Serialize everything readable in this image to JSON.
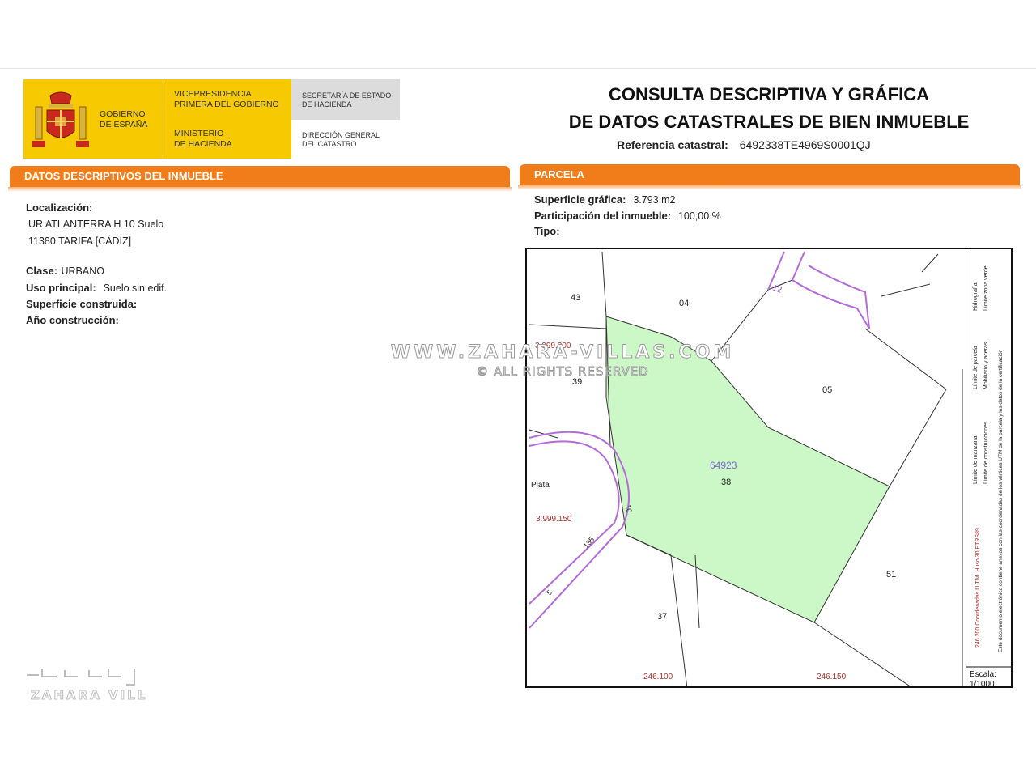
{
  "header": {
    "gobierno": [
      "GOBIERNO",
      "DE ESPAÑA"
    ],
    "vicepresidencia": [
      "VICEPRESIDENCIA",
      "PRIMERA DEL GOBIERNO"
    ],
    "ministerio": [
      "MINISTERIO",
      "DE HACIENDA"
    ],
    "secretaria": [
      "SECRETARÍA DE ESTADO",
      "DE HACIENDA"
    ],
    "direccion": [
      "DIRECCIÓN GENERAL",
      "DEL CATASTRO"
    ],
    "title_line1": "CONSULTA DESCRIPTIVA Y GRÁFICA",
    "title_line2": "DE DATOS CATASTRALES DE BIEN INMUEBLE",
    "ref_label": "Referencia catastral:",
    "ref_value": "6492338TE4969S0001QJ"
  },
  "left": {
    "bar_title": "DATOS DESCRIPTIVOS DEL INMUEBLE",
    "localizacion_label": "Localización:",
    "address_line1": "UR ATLANTERRA H 10 Suelo",
    "address_line2": "11380 TARIFA [CÁDIZ]",
    "clase_label": "Clase:",
    "clase_value": "URBANO",
    "uso_label": "Uso principal:",
    "uso_value": "Suelo sin edif.",
    "superficie_label": "Superficie construida:",
    "anio_label": "Año construcción:"
  },
  "right": {
    "bar_title": "PARCELA",
    "sup_label": "Superficie gráfica:",
    "sup_value": "3.793 m2",
    "part_label": "Participación del inmueble:",
    "part_value": "100,00 %",
    "tipo_label": "Tipo:"
  },
  "map": {
    "labels": {
      "p43": "43",
      "p04": "04",
      "p12": "12",
      "p05": "05",
      "p39": "39",
      "p64923": "64923",
      "p38": "38",
      "p51": "51",
      "p37": "37",
      "plata": "Plata",
      "s10": "10",
      "s135": "135",
      "s5": "5",
      "coord_y1": "3.999.200",
      "coord_y2": "3.999.150",
      "coord_x1": "246.100",
      "coord_x2": "246.150"
    },
    "legend": {
      "hidrografia": "Hidrografía",
      "zona_verde": "Límite zona verde",
      "parcela": "Límite de parcela",
      "mobiliario": "Mobiliario y aceras",
      "manzana": "Límite de manzana",
      "construcciones": "Límite de construcciones",
      "utm": "246.200 Coordenadas U.T.M. Huso 30 ETRS89",
      "documento": "Este documento electrónico contiene anexos con las coordenadas de los vértices UTM de la parcela y los datos de la certificación",
      "escala_label": "Escala:",
      "escala_value": "1/1000"
    },
    "colors": {
      "parcel_fill": "#ccf7c6",
      "street": "#b46ad8",
      "coords": "#b0302a",
      "accent": "#f07d1a"
    }
  },
  "watermark": {
    "site": "WWW.ZAHARA-VILLAS.COM",
    "rights": "© ALL RIGHTS RESERVED",
    "logo": "ZAHARA VILLAS"
  }
}
